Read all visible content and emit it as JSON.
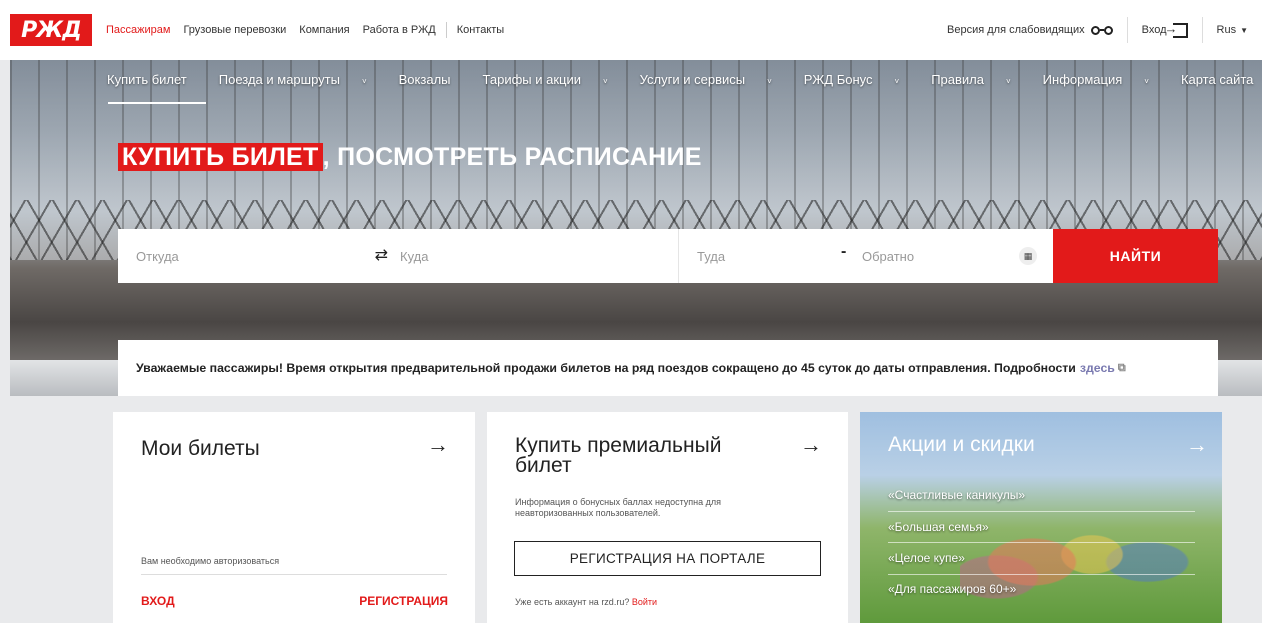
{
  "brand": {
    "logo_text": "РЖД",
    "accent": "#e21a1a"
  },
  "topnav": {
    "items": [
      "Пассажирам",
      "Грузовые перевозки",
      "Компания",
      "Работа в РЖД",
      "Контакты"
    ],
    "active_index": 0,
    "accessibility_label": "Версия для слабовидящих",
    "login_label": "Вход",
    "language": "Rus"
  },
  "mainnav": {
    "items": [
      {
        "label": "Купить билет",
        "dropdown": false
      },
      {
        "label": "Поезда и маршруты",
        "dropdown": true
      },
      {
        "label": "Вокзалы",
        "dropdown": false
      },
      {
        "label": "Тарифы и акции",
        "dropdown": true
      },
      {
        "label": "Услуги и сервисы",
        "dropdown": true
      },
      {
        "label": "РЖД Бонус",
        "dropdown": true
      },
      {
        "label": "Правила",
        "dropdown": true
      },
      {
        "label": "Информация",
        "dropdown": true
      },
      {
        "label": "Карта сайта",
        "dropdown": false
      }
    ]
  },
  "hero": {
    "headline_highlight": "КУПИТЬ БИЛЕТ",
    "headline_rest": ", ПОСМОТРЕТЬ РАСПИСАНИЕ"
  },
  "search": {
    "from_placeholder": "Откуда",
    "to_placeholder": "Куда",
    "there_placeholder": "Туда",
    "back_placeholder": "Обратно",
    "dash": "-",
    "submit_label": "НАЙТИ"
  },
  "notice": {
    "text": "Уважаемые пассажиры! Время открытия предварительной продажи билетов на ряд поездов сокращено до 45 суток до даты отправления. Подробности",
    "link_text": "здесь"
  },
  "cards": {
    "tickets": {
      "title": "Мои билеты",
      "auth_text": "Вам необходимо авторизоваться",
      "login_label": "ВХОД",
      "register_label": "РЕГИСТРАЦИЯ"
    },
    "premium": {
      "title": "Купить премиальный билет",
      "info": "Информация о бонусных баллах недоступна для неавторизованных пользователей.",
      "register_button": "РЕГИСТРАЦИЯ НА ПОРТАЛЕ",
      "account_text": "Уже есть аккаунт на rzd.ru?",
      "account_link": "Войти"
    },
    "promos": {
      "title": "Акции и скидки",
      "items": [
        "«Счастливые каникулы»",
        "«Большая семья»",
        "«Целое купе»",
        "«Для пассажиров 60+»"
      ]
    }
  }
}
